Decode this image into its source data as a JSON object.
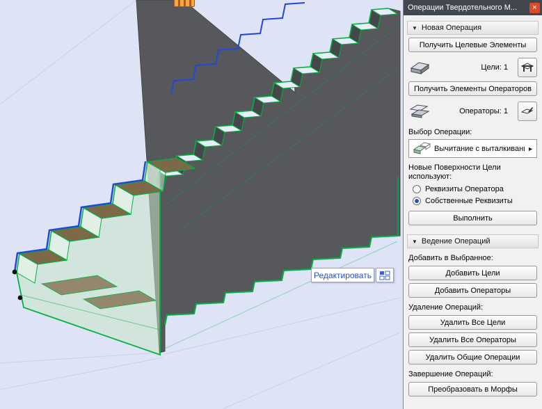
{
  "viewport": {
    "tooltip_label": "Редактировать"
  },
  "panel": {
    "title": "Операции Твердотельного М...",
    "icons": {
      "close_glyph": "×",
      "collapse_triangle": "▼",
      "flyout_arrow": "►",
      "target_elements_icon": "target-slab-3d",
      "operator_elements_icon": "operator-slabs-3d",
      "pick_target_icon": "pick-target-tool",
      "pick_operator_icon": "pick-operator-tool",
      "operation_icon": "subtract-solids"
    },
    "new_operation": {
      "header": "Новая Операция",
      "get_targets_button": "Получить Целевые Элементы",
      "targets_count_label": "Цели: 1",
      "get_operators_button": "Получить Элементы Операторов",
      "operators_count_label": "Операторы: 1",
      "choose_operation_label": "Выбор Операции:",
      "operation_value": "Вычитание с выталкивание...",
      "surfaces_label_line1": "Новые Поверхности Цели",
      "surfaces_label_line2": "используют:",
      "radio_operator_label": "Реквизиты Оператора",
      "radio_own_label": "Собственные Реквизиты",
      "radio_selected": "Собственные Реквизиты",
      "execute_button": "Выполнить"
    },
    "manage_operations": {
      "header": "Ведение Операций",
      "add_to_selected_label": "Добавить в Выбранное:",
      "add_targets_button": "Добавить Цели",
      "add_operators_button": "Добавить Операторы",
      "delete_operations_label": "Удаление Операций:",
      "delete_all_targets_button": "Удалить Все Цели",
      "delete_all_operators_button": "Удалить Все Операторы",
      "delete_common_operations_button": "Удалить Общие Операции",
      "finish_operations_label": "Завершение Операций:",
      "convert_to_morphs_button": "Преобразовать в Морфы"
    }
  },
  "colors": {
    "background": "#dfe3f6",
    "wall_gray": "#57585c",
    "selection_green": "#00b340",
    "selection_blue": "#2347d6",
    "tread_brown": "#7d6848",
    "tooltip_blue": "#2b4bc4",
    "close_button_red": "#dd4a26"
  }
}
